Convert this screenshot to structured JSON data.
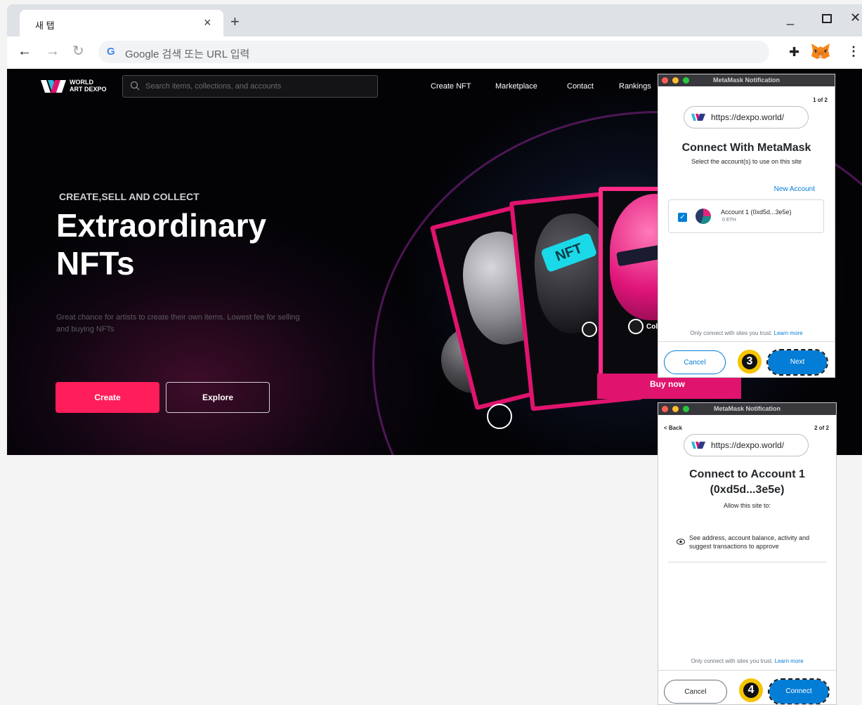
{
  "browser": {
    "tab_title": "새 탭",
    "tab_close_glyph": "×",
    "new_tab_glyph": "+",
    "minimize_glyph": "_",
    "close_glyph": "✕",
    "omnibox_placeholder": "Google 검색 또는 URL 입력",
    "omnibox_g": "G",
    "icons": [
      "back-icon",
      "forward-icon",
      "reload-icon",
      "extensions-puzzle-icon",
      "metamask-fox-icon",
      "menu-kebab-icon"
    ]
  },
  "site": {
    "logo_line1": "WORLD",
    "logo_line2": "ART DEXPO",
    "search_placeholder": "Search items, collections, and accounts",
    "nav": [
      "Create NFT",
      "Marketplace",
      "Contact",
      "Rankings"
    ],
    "hero_kicker": "CREATE,SELL AND COLLECT",
    "hero_title_line1": "Extraordinary",
    "hero_title_line2": "NFTs",
    "hero_sub": "Great chance for artists to create their own items. Lowest fee for selling and buying NFTs",
    "create_label": "Create",
    "explore_label": "Explore",
    "card_visor_text": "NFT",
    "card_badge_label": "Col",
    "buy_now_label": "Buy now",
    "accent_color": "#ff1e5a"
  },
  "metamask_1": {
    "window_title": "MetaMask Notification",
    "step": "1 of 2",
    "site_url": "https://dexpo.world/",
    "heading": "Connect With MetaMask",
    "subheading": "Select the account(s) to use on this site",
    "new_account": "New Account",
    "account_name": "Account 1 (0xd5d...3e5e)",
    "account_balance": "0 ETH",
    "account_checked": true,
    "trust_text": "Only connect with sites you trust.",
    "learn_more": "Learn more",
    "cancel_label": "Cancel",
    "next_label": "Next",
    "annotation_step": "3"
  },
  "metamask_2": {
    "window_title": "MetaMask Notification",
    "back_label": "< Back",
    "step": "2 of 2",
    "site_url": "https://dexpo.world/",
    "heading_line1": "Connect to Account 1",
    "heading_line2": "(0xd5d...3e5e)",
    "subheading": "Allow this site to:",
    "permission": "See address, account balance, activity and suggest transactions to approve",
    "trust_text": "Only connect with sites you trust.",
    "learn_more": "Learn more",
    "cancel_label": "Cancel",
    "connect_label": "Connect",
    "annotation_step": "4"
  },
  "colors": {
    "metamask_blue": "#037dd6",
    "card_pink": "#e0146e",
    "step_badge_yellow": "#f5c400"
  }
}
